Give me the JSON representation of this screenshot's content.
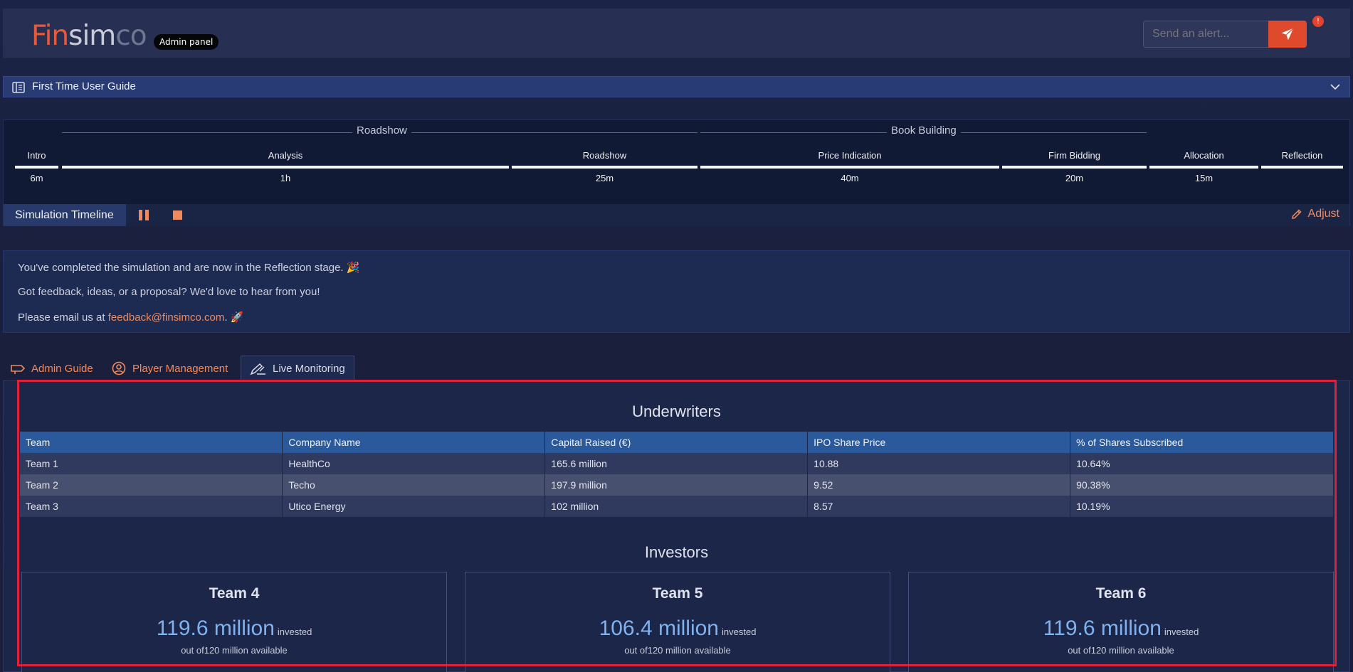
{
  "header": {
    "logo": {
      "fin": "Fin",
      "sim": "sim",
      "co": "co"
    },
    "badge": "Admin panel",
    "alert_placeholder": "Send an alert..."
  },
  "guide": {
    "label": "First Time User Guide"
  },
  "timeline": {
    "groups": [
      {
        "label": "Roadshow"
      },
      {
        "label": "Book Building"
      }
    ],
    "stages": [
      {
        "name": "Intro",
        "duration": "6m"
      },
      {
        "name": "Analysis",
        "duration": "1h"
      },
      {
        "name": "Roadshow",
        "duration": "25m"
      },
      {
        "name": "Price Indication",
        "duration": "40m"
      },
      {
        "name": "Firm Bidding",
        "duration": "20m"
      },
      {
        "name": "Allocation",
        "duration": "15m"
      },
      {
        "name": "Reflection",
        "duration": ""
      }
    ],
    "footer_title": "Simulation Timeline",
    "adjust_label": "Adjust"
  },
  "info": {
    "line1": "You've completed the simulation and are now in the Reflection stage. 🎉",
    "line2": "Got feedback, ideas, or a proposal? We'd love to hear from you!",
    "line3_prefix": "Please email us at ",
    "email": "feedback@finsimco.com",
    "line3_suffix": ". 🚀"
  },
  "tabs": [
    {
      "label": "Admin Guide"
    },
    {
      "label": "Player Management"
    },
    {
      "label": "Live Monitoring"
    }
  ],
  "underwriters": {
    "title": "Underwriters",
    "columns": [
      "Team",
      "Company Name",
      "Capital Raised (€)",
      "IPO Share Price",
      "% of Shares Subscribed"
    ],
    "rows": [
      [
        "Team 1",
        "HealthCo",
        "165.6 million",
        "10.88",
        "10.64%"
      ],
      [
        "Team 2",
        "Techo",
        "197.9 million",
        "9.52",
        "90.38%"
      ],
      [
        "Team 3",
        "Utico Energy",
        "102 million",
        "8.57",
        "10.19%"
      ]
    ]
  },
  "investors": {
    "title": "Investors",
    "cards": [
      {
        "team": "Team 4",
        "amount": "119.6 million",
        "invested": "invested",
        "available": "out of120 million available"
      },
      {
        "team": "Team 5",
        "amount": "106.4 million",
        "invested": "invested",
        "available": "out of120 million available"
      },
      {
        "team": "Team 6",
        "amount": "119.6 million",
        "invested": "invested",
        "available": "out of120 million available"
      }
    ]
  },
  "colors": {
    "accent": "#f08a5d",
    "send_button": "#e04a2c",
    "table_header": "#2a5a9c",
    "highlight": "#e1213a"
  }
}
